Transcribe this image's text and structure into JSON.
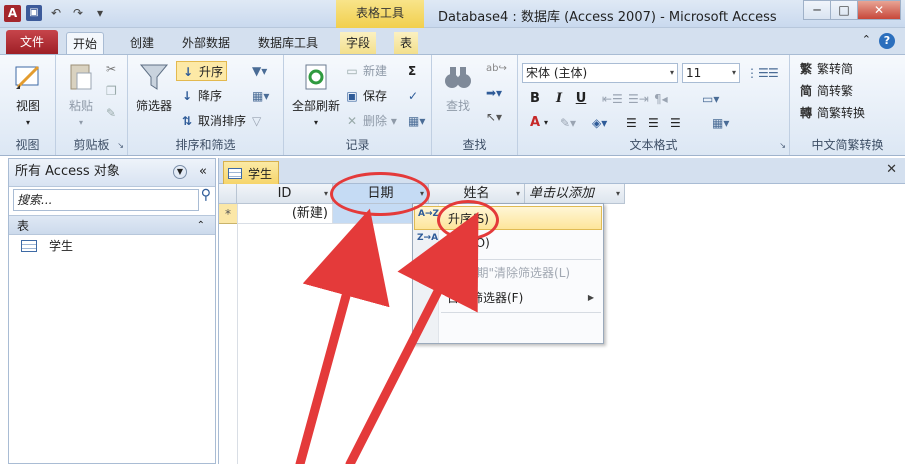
{
  "app": {
    "title": "Database4 : 数据库 (Access 2007) - Microsoft Access",
    "icon_letter": "A",
    "context_tab_group": "表格工具"
  },
  "window_buttons": {
    "minimize": "─",
    "restore": "□",
    "close": "✕"
  },
  "ribbon_tabs": [
    "文件",
    "开始",
    "创建",
    "外部数据",
    "数据库工具",
    "字段",
    "表"
  ],
  "ribbon": {
    "views": {
      "view_label": "视图",
      "group": "视图"
    },
    "clipboard": {
      "paste_label": "粘贴",
      "group": "剪贴板"
    },
    "sort_filter": {
      "filter_label": "筛选器",
      "ascending": "升序",
      "descending": "降序",
      "remove_sort": "取消排序",
      "group": "排序和筛选"
    },
    "records": {
      "refresh_all": "全部刷新",
      "new": "新建",
      "save": "保存",
      "delete": "删除",
      "group": "记录"
    },
    "find": {
      "find_label": "查找",
      "group": "查找"
    },
    "text_format": {
      "font_name": "宋体 (主体)",
      "font_size": "11",
      "bold": "B",
      "italic": "I",
      "underline": "U",
      "font_color_letter": "A",
      "group": "文本格式"
    },
    "chinese_conversion": {
      "trad_to_simp": "繁转简",
      "simp_to_trad": "简转繁",
      "convert": "简繁转换",
      "group": "中文简繁转换"
    }
  },
  "nav_pane": {
    "title": "所有 Access 对象",
    "search_placeholder": "搜索...",
    "section": "表",
    "items": [
      "学生"
    ]
  },
  "document": {
    "tab_label": "学生",
    "columns": [
      "ID",
      "日期",
      "姓名",
      "单击以添加"
    ],
    "new_row_marker": "*",
    "new_row_id": "(新建)"
  },
  "dropdown_menu": {
    "items": [
      {
        "icon": "A→Z",
        "label": "升序(S)"
      },
      {
        "icon": "Z→A",
        "label": "降序(O)"
      },
      {
        "icon": "✖",
        "label": "从\"日期\"清除筛选器(L)"
      },
      {
        "icon": "",
        "label": "日期筛选器(F)"
      }
    ]
  },
  "colors": {
    "annotation_red": "#e43a3a",
    "file_tab": "#a4262c",
    "context_tab": "#f1cf4d",
    "menu_highlight": "#fde59a"
  }
}
